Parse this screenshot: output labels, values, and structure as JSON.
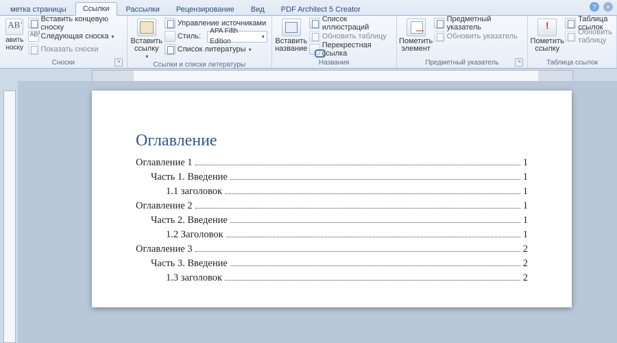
{
  "tabs": [
    {
      "label": "метка страницы"
    },
    {
      "label": "Ссылки"
    },
    {
      "label": "Рассылки"
    },
    {
      "label": "Рецензирование"
    },
    {
      "label": "Вид"
    },
    {
      "label": "PDF Architect 5 Creator"
    }
  ],
  "active_tab_index": 1,
  "ribbon": {
    "g0": {
      "big": "авить\nноску",
      "r1": "Вставить концевую сноску",
      "r2": "Следующая сноска",
      "r3": "Показать сноски",
      "label": "Сноски"
    },
    "g1": {
      "big": "Вставить\nссылку",
      "r1": "Управление источниками",
      "r2": "Стиль:",
      "style_value": "APA Fifth Edition",
      "r3": "Список литературы",
      "label": "Ссылки и списки литературы"
    },
    "g2": {
      "big": "Вставить\nназвание",
      "r1": "Список иллюстраций",
      "r2": "Обновить таблицу",
      "r3": "Перекрестная ссылка",
      "label": "Названия"
    },
    "g3": {
      "big": "Пометить\nэлемент",
      "r1": "Предметный указатель",
      "r2": "Обновить указатель",
      "label": "Предметный указатель"
    },
    "g4": {
      "big": "Пометить\nссылку",
      "r1": "Таблица ссылок",
      "r2": "Обновить таблицу",
      "label": "Таблица ссылок"
    }
  },
  "document": {
    "title": "Оглавление",
    "toc": [
      {
        "level": 1,
        "text": "Оглавление 1",
        "page": "1"
      },
      {
        "level": 2,
        "text": "Часть 1. Введение",
        "page": "1"
      },
      {
        "level": 3,
        "text": "1.1 заголовок",
        "page": "1"
      },
      {
        "level": 1,
        "text": "Оглавление 2",
        "page": "1"
      },
      {
        "level": 2,
        "text": "Часть 2. Введение",
        "page": "1"
      },
      {
        "level": 3,
        "text": "1.2 Заголовок",
        "page": "1"
      },
      {
        "level": 1,
        "text": "Оглавление 3",
        "page": "2"
      },
      {
        "level": 2,
        "text": "Часть 3. Введение",
        "page": "2"
      },
      {
        "level": 3,
        "text": "1.3 заголовок",
        "page": "2"
      }
    ]
  }
}
